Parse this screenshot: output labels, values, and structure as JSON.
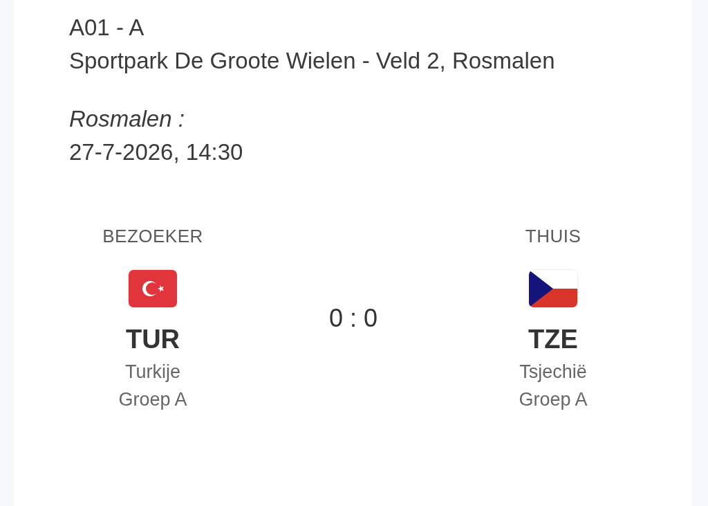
{
  "header": {
    "match_code": "A01 - A",
    "venue": "Sportpark De Groote Wielen - Veld 2, Rosmalen",
    "city": "Rosmalen :",
    "datetime": "27-7-2026, 14:30"
  },
  "match": {
    "teams": [
      {
        "role": "BEZOEKER",
        "kind": "turkey",
        "code": "TUR",
        "name": "Turkije",
        "group": "Groep A"
      },
      {
        "role": "THUIS",
        "kind": "czechia",
        "code": "TZE",
        "name": "Tsjechië",
        "group": "Groep A"
      }
    ],
    "score": "0 : 0"
  }
}
